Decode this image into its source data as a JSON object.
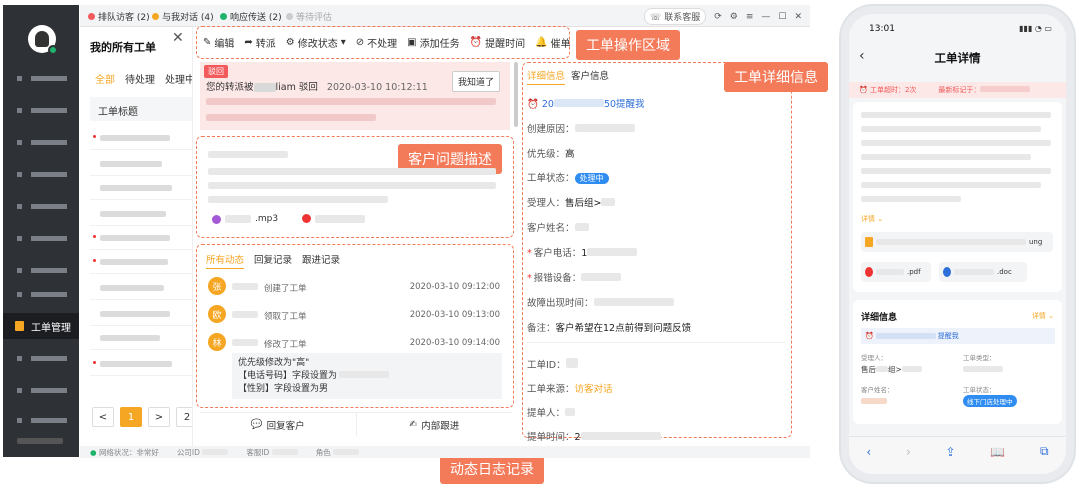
{
  "top_tabs": [
    {
      "label": "排队访客 (2)",
      "color": "#f25b5b"
    },
    {
      "label": "与我对话 (4)",
      "color": "#f5a623"
    },
    {
      "label": "响应传送 (2)",
      "color": "#1fb36b"
    },
    {
      "label": "等待评估",
      "color": "#bbbbbb"
    }
  ],
  "contact_service": "联系客服",
  "sidebar": {
    "active_label": "工单管理"
  },
  "list": {
    "title": "我的所有工单",
    "tabs": [
      "全部",
      "待处理",
      "处理中"
    ],
    "column_header": "工单标题",
    "pager": [
      "<",
      "1",
      ">",
      "2"
    ]
  },
  "toolbar": [
    "编辑",
    "转派",
    "修改状态",
    "不处理",
    "添加任务",
    "提醒时间",
    "催单"
  ],
  "callouts": {
    "toolbar": "工单操作区域",
    "problem": "客户问题描述",
    "detail": "工单详细信息",
    "log": "动态日志记录"
  },
  "reject": {
    "tag": "驳回",
    "text_prefix": "您的转派被",
    "text_suffix": "liam 驳回",
    "time": "2020-03-10 10:12:11",
    "ack_button": "我知道了"
  },
  "attachments": [
    ".mp3"
  ],
  "log": {
    "tabs": [
      "所有动态",
      "回复记录",
      "跟进记录"
    ],
    "entries": [
      {
        "avatar": "张",
        "action": "创建了工单",
        "time": "2020-03-10 09:12:00",
        "color": "#f5a623"
      },
      {
        "avatar": "欧",
        "action": "领取了工单",
        "time": "2020-03-10 09:13:00",
        "color": "#f5a623"
      },
      {
        "avatar": "林",
        "action": "修改了工单",
        "time": "2020-03-10 09:14:00",
        "color": "#f5a623"
      }
    ],
    "change_lines": [
      "优先级修改为\"高\"",
      "【电话号码】字段设置为",
      "【性别】字段设置为男"
    ],
    "reply_button": "回复客户",
    "internal_button": "内部跟进"
  },
  "detail": {
    "tabs": [
      "详细信息",
      "客户信息"
    ],
    "reminder_prefix": "20",
    "reminder_suffix": "50提醒我",
    "fields": [
      {
        "label": "创建原因：",
        "value": ""
      },
      {
        "label": "优先级：",
        "value": "高"
      },
      {
        "label": "工单状态：",
        "value": "处理中",
        "badge": true
      },
      {
        "label": "受理人：",
        "value": "售后组>"
      },
      {
        "label": "客户姓名：",
        "value": ""
      },
      {
        "label": "客户电话：",
        "value": "1",
        "required": true
      },
      {
        "label": "报错设备：",
        "value": "",
        "required": true
      },
      {
        "label": "故障出现时间：",
        "value": ""
      },
      {
        "label": "备注：",
        "value": "客户希望在12点前得到问题反馈"
      },
      {
        "label": "工单ID：",
        "value": ""
      },
      {
        "label": "工单来源：",
        "value": "访客对话",
        "accent": true
      },
      {
        "label": "提单人：",
        "value": ""
      },
      {
        "label": "提单时间：",
        "value": "2"
      }
    ]
  },
  "statusbar": [
    "网络状况：非常好",
    "公司ID",
    "客服ID",
    "角色"
  ],
  "phone": {
    "time": "13:01",
    "title": "工单详情",
    "alert_count": "工单超时：2次",
    "alert_last": "最新标记于：",
    "more": "详情",
    "file1_suffix": "ung",
    "file2": ".pdf",
    "file3": ".doc",
    "section_title": "详细信息",
    "section_more": "详情",
    "reminder": "提醒我",
    "labels": [
      "受理人：",
      "工单类型：",
      "客户姓名：",
      "工单状态："
    ],
    "assignee": "售后",
    "assignee2": "组>",
    "status_badge": "线下门店处理中"
  },
  "colors": {
    "accent": "#f47b5a",
    "brand": "#f5a623",
    "link": "#2f6fd8"
  }
}
